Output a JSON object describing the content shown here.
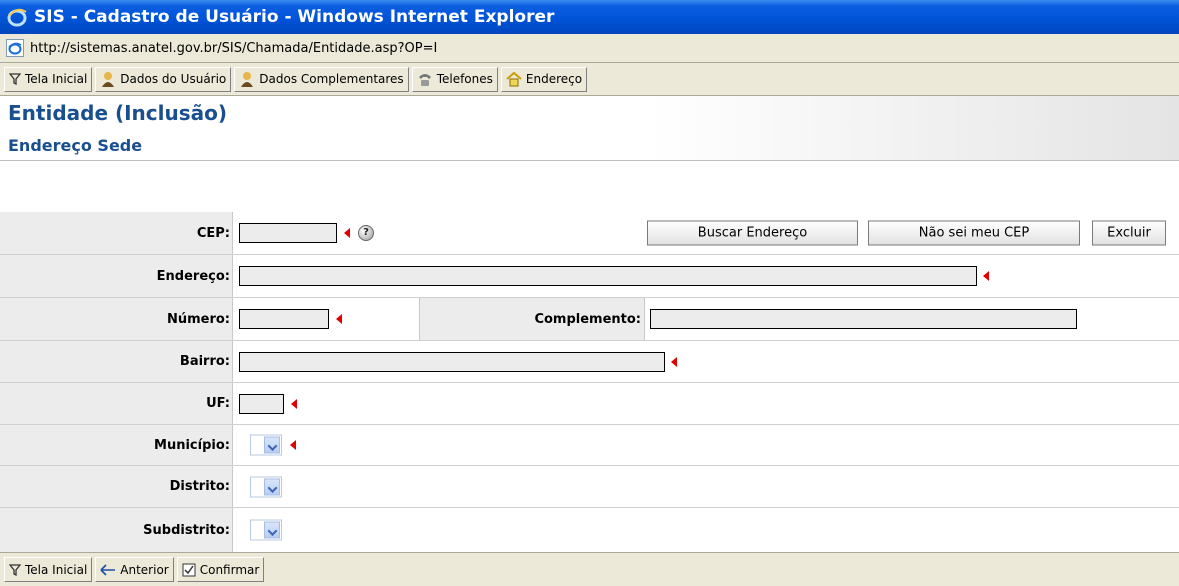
{
  "window": {
    "title": "SIS - Cadastro de Usuário - Windows Internet Explorer"
  },
  "address": {
    "url": "http://sistemas.anatel.gov.br/SIS/Chamada/Entidade.asp?OP=I"
  },
  "toolbar": {
    "items": [
      {
        "label": "Tela Inicial",
        "icon": "filter-icon"
      },
      {
        "label": "Dados do Usuário",
        "icon": "user-icon"
      },
      {
        "label": "Dados Complementares",
        "icon": "user-icon"
      },
      {
        "label": "Telefones",
        "icon": "phone-icon"
      },
      {
        "label": "Endereço",
        "icon": "house-icon"
      }
    ]
  },
  "page": {
    "title": "Entidade (Inclusão)",
    "subtitle": "Endereço Sede"
  },
  "form": {
    "cep": {
      "label": "CEP:",
      "value": "",
      "help": "?"
    },
    "buscar_button": "Buscar Endereço",
    "nao_sei_button": "Não sei meu CEP",
    "excluir_button": "Excluir",
    "endereco": {
      "label": "Endereço:",
      "value": ""
    },
    "numero": {
      "label": "Número:",
      "value": ""
    },
    "complemento": {
      "label": "Complemento:",
      "value": ""
    },
    "bairro": {
      "label": "Bairro:",
      "value": ""
    },
    "uf": {
      "label": "UF:",
      "value": ""
    },
    "municipio": {
      "label": "Município:"
    },
    "distrito": {
      "label": "Distrito:"
    },
    "subdistrito": {
      "label": "Subdistrito:"
    }
  },
  "bottombar": {
    "items": [
      {
        "label": "Tela Inicial",
        "icon": "filter-icon"
      },
      {
        "label": "Anterior",
        "icon": "arrow-left-icon"
      },
      {
        "label": "Confirmar",
        "icon": "checkbox-icon"
      }
    ]
  },
  "colors": {
    "title_bar": "#0052d6",
    "heading": "#1a4f8f",
    "required_marker": "#e00000"
  }
}
